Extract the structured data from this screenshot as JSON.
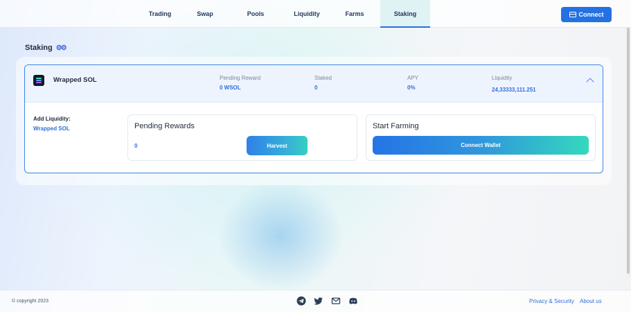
{
  "header": {
    "nav": [
      {
        "label": "Trading",
        "active": false
      },
      {
        "label": "Swap",
        "active": false
      },
      {
        "label": "Pools",
        "active": false
      },
      {
        "label": "Liquidity",
        "active": false
      },
      {
        "label": "Farms",
        "active": false
      },
      {
        "label": "Staking",
        "active": true
      }
    ],
    "connect_label": "Connect"
  },
  "page": {
    "title": "Staking"
  },
  "pool": {
    "token_name": "Wrapped SOL",
    "stats": [
      {
        "label": "Pending Reward",
        "value": "0 WSOL"
      },
      {
        "label": "Staked",
        "value": "0"
      },
      {
        "label": "APY",
        "value": "0%"
      },
      {
        "label": "Liquidity",
        "value": "24,33333,111.251"
      }
    ],
    "add_liquidity_label": "Add Liquidity:",
    "add_liquidity_link": "Wrapped SOL",
    "pending_rewards": {
      "title": "Pending Rewards",
      "value": "0",
      "button": "Harvest"
    },
    "start_farming": {
      "title": "Start Farming",
      "button": "Connect Wallet"
    }
  },
  "footer": {
    "copyright": "© copyright 2023",
    "social_icons": [
      "telegram-icon",
      "twitter-icon",
      "mail-icon",
      "discord-icon"
    ],
    "links": [
      "Privacy & Security",
      "About us"
    ]
  },
  "colors": {
    "primary": "#2471e3",
    "accent_teal": "#35d8bd",
    "link_blue": "#2f6fd8",
    "card_border": "#3a87e6"
  }
}
